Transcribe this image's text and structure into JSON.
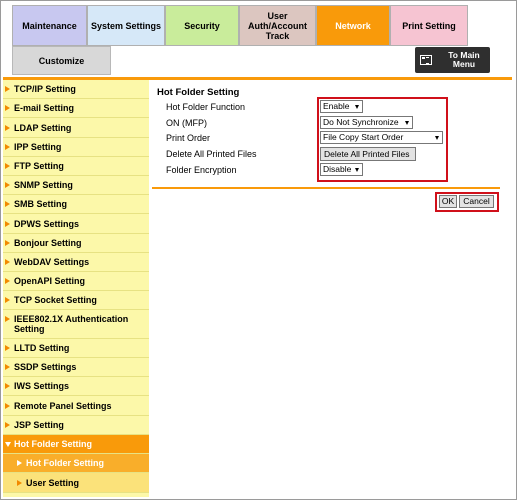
{
  "tabs": {
    "maintenance": "Maintenance",
    "system_settings": "System Settings",
    "security": "Security",
    "user_auth": "User\nAuth/Account\nTrack",
    "network": "Network",
    "print_setting": "Print Setting",
    "customize": "Customize"
  },
  "main_menu": {
    "label": "To Main\nMenu",
    "icon": "main-menu-icon"
  },
  "sidebar": {
    "items": [
      {
        "label": "TCP/IP Setting"
      },
      {
        "label": "E-mail Setting"
      },
      {
        "label": "LDAP Setting"
      },
      {
        "label": "IPP Setting"
      },
      {
        "label": "FTP Setting"
      },
      {
        "label": "SNMP Setting"
      },
      {
        "label": "SMB Setting"
      },
      {
        "label": "DPWS Settings"
      },
      {
        "label": "Bonjour Setting"
      },
      {
        "label": "WebDAV Settings"
      },
      {
        "label": "OpenAPI Setting"
      },
      {
        "label": "TCP Socket Setting"
      },
      {
        "label": "IEEE802.1X Authentication Setting"
      },
      {
        "label": "LLTD Setting"
      },
      {
        "label": "SSDP Settings"
      },
      {
        "label": "IWS Settings"
      },
      {
        "label": "Remote Panel Settings"
      },
      {
        "label": "JSP Setting"
      },
      {
        "label": "Hot Folder Setting"
      },
      {
        "label": "Hot Folder Setting"
      },
      {
        "label": "User Setting"
      }
    ]
  },
  "content": {
    "title": "Hot Folder Setting",
    "rows": {
      "function_label": "Hot Folder Function",
      "function_value": "Enable",
      "on_mfp_label": "ON (MFP)",
      "on_mfp_value": "Do Not Synchronize",
      "print_order_label": "Print Order",
      "print_order_value": "File Copy Start Order",
      "delete_label": "Delete All Printed Files",
      "delete_button": "Delete All Printed Files",
      "encryption_label": "Folder Encryption",
      "encryption_value": "Disable"
    },
    "ok_label": "OK",
    "cancel_label": "Cancel"
  },
  "colors": {
    "accent": "#f99a0a",
    "sidebar_bg": "#fcf8a9",
    "highlight_box": "#d0101a"
  }
}
